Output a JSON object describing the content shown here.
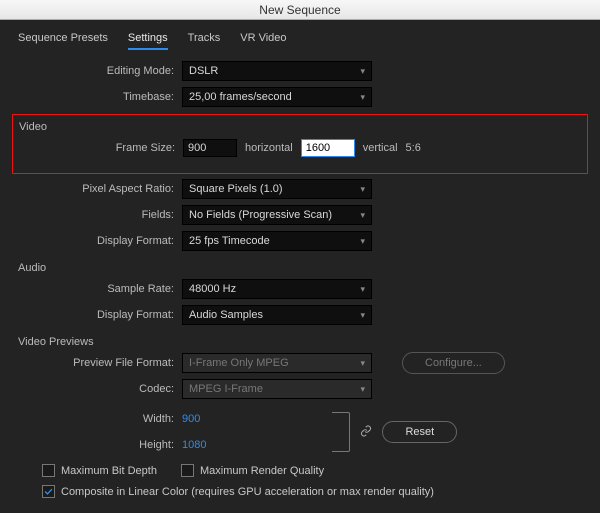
{
  "titlebar": "New Sequence",
  "tabs": [
    "Sequence Presets",
    "Settings",
    "Tracks",
    "VR Video"
  ],
  "active_tab_index": 1,
  "editing_mode": {
    "label": "Editing Mode:",
    "value": "DSLR"
  },
  "timebase": {
    "label": "Timebase:",
    "value": "25,00  frames/second"
  },
  "video_section": {
    "title": "Video",
    "frame_size_label": "Frame Size:",
    "width": "900",
    "width_suffix": "horizontal",
    "height": "1600",
    "height_suffix": "vertical",
    "ratio": "5:6",
    "pixel_aspect": {
      "label": "Pixel Aspect Ratio:",
      "value": "Square Pixels (1.0)"
    },
    "fields": {
      "label": "Fields:",
      "value": "No Fields (Progressive Scan)"
    },
    "display_format": {
      "label": "Display Format:",
      "value": "25 fps Timecode"
    }
  },
  "audio_section": {
    "title": "Audio",
    "sample_rate": {
      "label": "Sample Rate:",
      "value": "48000 Hz"
    },
    "display_format": {
      "label": "Display Format:",
      "value": "Audio Samples"
    }
  },
  "previews_section": {
    "title": "Video Previews",
    "preview_file_format": {
      "label": "Preview File Format:",
      "value": "I-Frame Only MPEG"
    },
    "codec": {
      "label": "Codec:",
      "value": "MPEG I-Frame"
    },
    "width": {
      "label": "Width:",
      "value": "900"
    },
    "height": {
      "label": "Height:",
      "value": "1080"
    },
    "configure_btn": "Configure...",
    "reset_btn": "Reset"
  },
  "checks": {
    "max_bit_depth": "Maximum Bit Depth",
    "max_render_quality": "Maximum Render Quality",
    "composite": "Composite in Linear Color (requires GPU acceleration or max render quality)"
  }
}
